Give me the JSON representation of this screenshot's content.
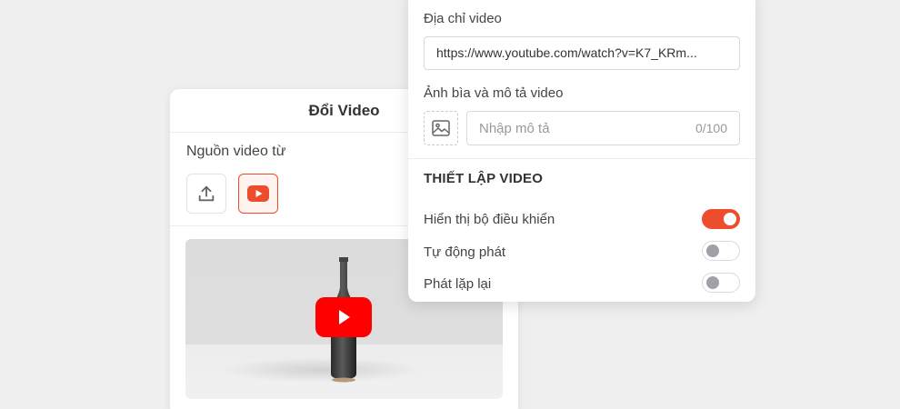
{
  "back_card": {
    "title": "Đổi Video",
    "source_label": "Nguồn video từ",
    "sources": [
      {
        "icon": "upload-icon",
        "selected": false
      },
      {
        "icon": "youtube-icon",
        "selected": true
      }
    ]
  },
  "panel": {
    "url_label": "Địa chỉ video",
    "url_value": "https://www.youtube.com/watch?v=K7_KRm...",
    "cover_label": "Ảnh bìa và mô tả video",
    "desc_placeholder": "Nhập mô tả",
    "desc_counter": "0/100",
    "section_title": "THIẾT LẬP VIDEO",
    "settings": [
      {
        "label": "Hiển thị bộ điều khiển",
        "on": true
      },
      {
        "label": "Tự động phát",
        "on": false
      },
      {
        "label": "Phát lặp lại",
        "on": false
      }
    ]
  },
  "colors": {
    "accent": "#ee4d2d",
    "youtube_red": "#ff0000",
    "background": "#efefef"
  }
}
